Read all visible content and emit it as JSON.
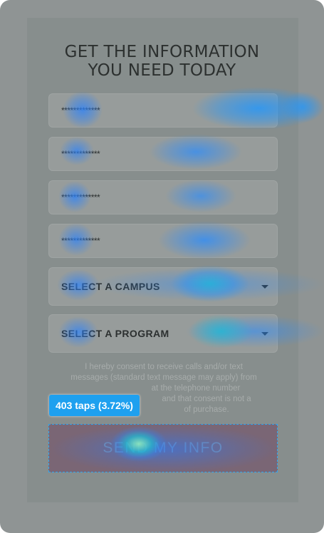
{
  "form": {
    "title_line1": "GET THE INFORMATION",
    "title_line2": "YOU NEED TODAY",
    "fields": [
      {
        "value": "*************"
      },
      {
        "value": "*************"
      },
      {
        "value": "*************"
      },
      {
        "value": "*************"
      }
    ],
    "campus_select": {
      "value": "SELECT A CAMPUS"
    },
    "program_select": {
      "value": "SELECT A PROGRAM"
    },
    "consent_lines": [
      "I hereby consent to receive calls and/or text",
      "messages (standard text message may apply) from",
      "at the telephone number",
      "and that consent is not a",
      "of purchase."
    ],
    "submit_label": "SEND MY INFO"
  },
  "heatmap": {
    "tooltip": "403 taps (3.72%)",
    "accent_color": "#1ea0ef",
    "target_outline_color": "#2ea6f0"
  }
}
